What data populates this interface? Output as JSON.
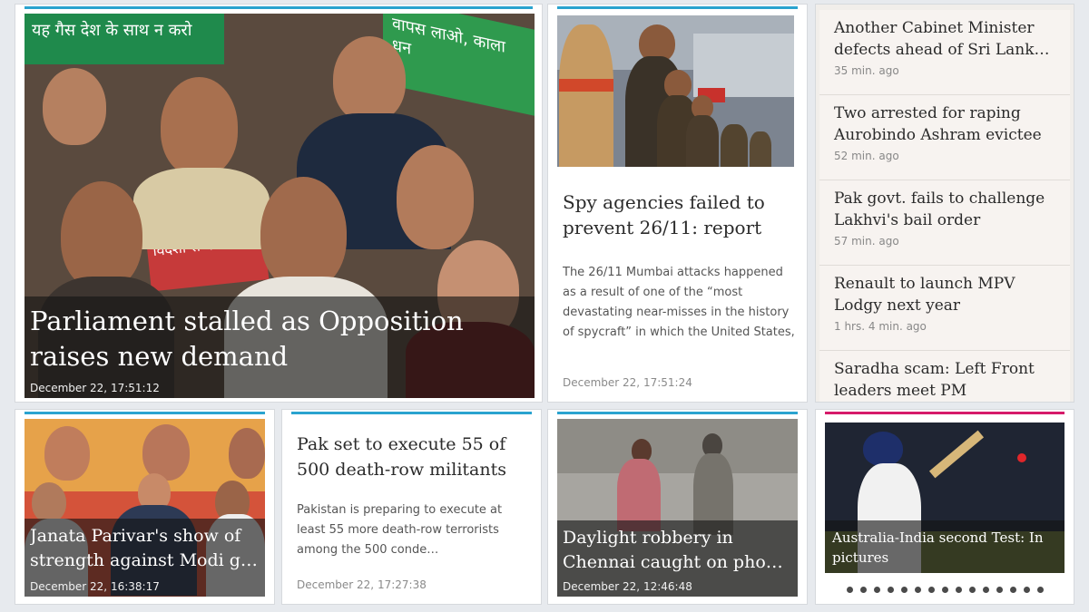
{
  "main_story": {
    "headline": "Parliament stalled as Opposition raises new demand",
    "timestamp": "December 22, 17:51:12",
    "banner_left": "यह गैस देश के साथ न करो",
    "banner_right": "वापस लाओ, काला धन",
    "banner_middle": "विदेशों से काला"
  },
  "spy_story": {
    "headline": "Spy agencies failed to prevent 26/11: report",
    "summary": "The 26/11 Mumbai attacks happened as a result of one of the “most devastating near-misses in the history of spycraft” in which the United States,",
    "timestamp": "December 22, 17:51:24"
  },
  "news_list": [
    {
      "title": "Another Cabinet Minister defects ahead of Sri Lank…",
      "time": "35 min. ago"
    },
    {
      "title": "Two arrested for raping Aurobindo Ashram evictee",
      "time": "52 min. ago"
    },
    {
      "title": "Pak govt. fails to challenge Lakhvi's bail order",
      "time": "57 min. ago"
    },
    {
      "title": "Renault to launch MPV Lodgy next year",
      "time": "1 hrs. 4 min. ago"
    },
    {
      "title": "Saradha scam: Left Front leaders meet PM",
      "time": ""
    }
  ],
  "janata_story": {
    "headline": "Janata Parivar's show of strength against Modi g…",
    "timestamp": "December 22, 16:38:17"
  },
  "pak_story": {
    "headline": "Pak set to execute 55 of 500 death-row militants",
    "summary": "Pakistan is preparing to execute at least 55 more death-row terrorists among the 500 conde…",
    "timestamp": "December 22, 17:27:38"
  },
  "chennai_story": {
    "headline": "Daylight robbery in Chennai caught on pho…",
    "timestamp": "December 22, 12:46:48"
  },
  "cricket_story": {
    "caption": "Australia-India second Test: In pictures",
    "dots_count": 15
  },
  "colors": {
    "accent_blue": "#2aa3cf",
    "accent_pink": "#d61a6a",
    "background": "#e7eaee"
  }
}
